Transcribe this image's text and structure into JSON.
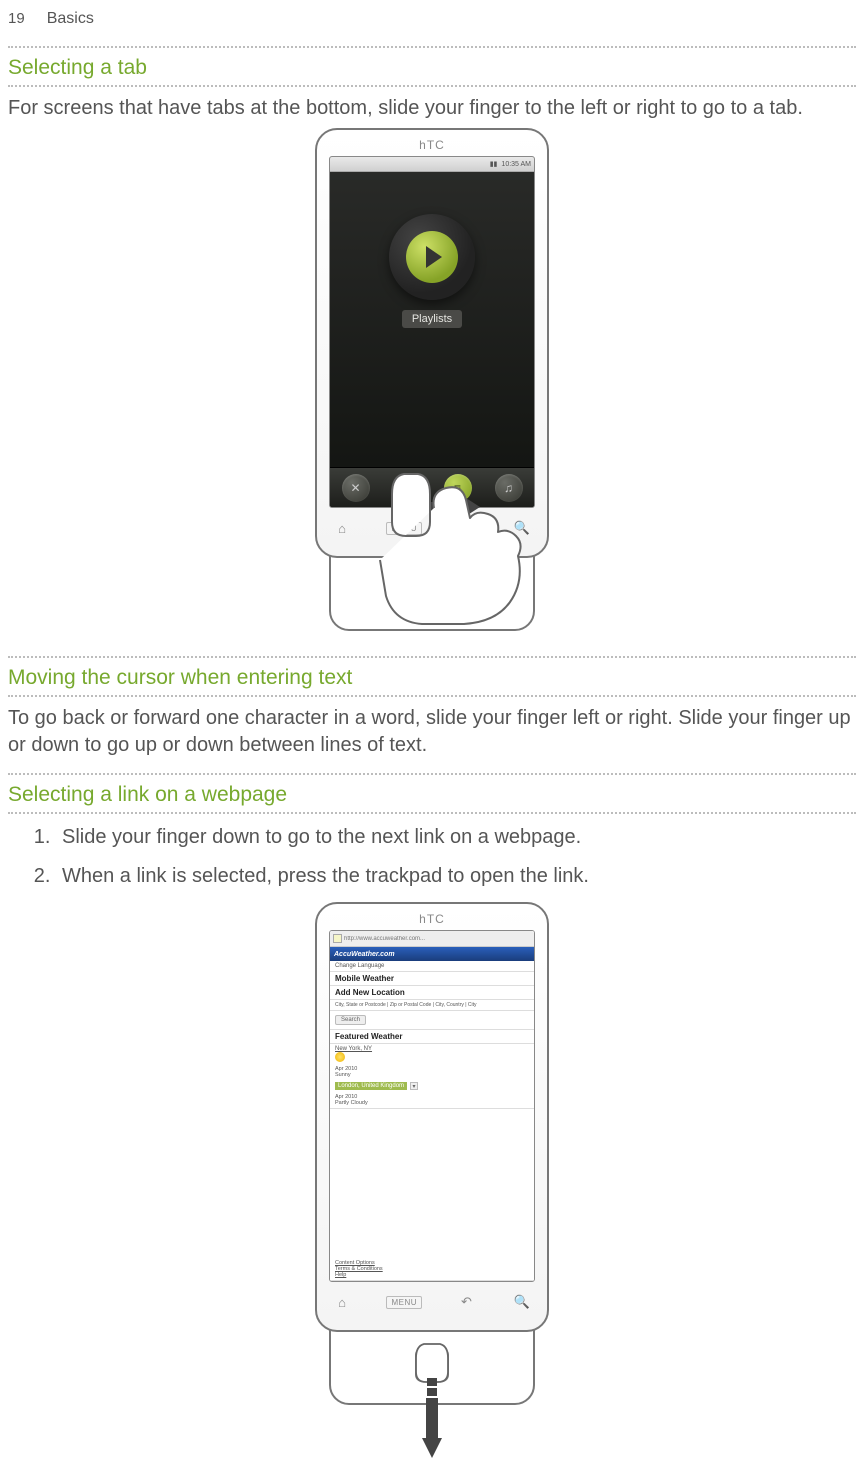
{
  "page": {
    "number": "19",
    "chapter": "Basics"
  },
  "sections": {
    "selecting_tab": {
      "heading": "Selecting a tab",
      "body": "For screens that have tabs at the bottom, slide your finger to the left or right to go to a tab."
    },
    "moving_cursor": {
      "heading": "Moving the cursor when entering text",
      "body": "To go back or forward one character in a word, slide your finger left or right. Slide your finger up or down to go up or down between lines of text."
    },
    "selecting_link": {
      "heading": "Selecting a link on a webpage",
      "steps": [
        "Slide your finger down to go to the next link on a webpage.",
        "When a link is selected, press the trackpad to open the link."
      ]
    }
  },
  "phone1": {
    "logo": "hTC",
    "status_time": "10:35 AM",
    "app_label": "Playlists",
    "tab_icons": [
      "✕",
      "▣",
      "≡",
      "♫"
    ],
    "hw_menu": "MENU"
  },
  "phone2": {
    "logo": "hTC",
    "url": "http://www.accuweather.com...",
    "banner": "AccuWeather.com",
    "lang": "Change Language",
    "mobile_weather": "Mobile Weather",
    "add_loc": "Add New Location",
    "hint": "City, State or Postcode | Zip or Postal Code | City, Country | City",
    "search_btn": "Search",
    "featured": "Featured Weather",
    "city1": "New York, NY",
    "date1": "Apr 2010",
    "cond1": "Sunny",
    "selected_link": "London, United Kingdom",
    "date2": "Apr 2010",
    "cond2": "Partly Cloudy",
    "footer1": "Content Options",
    "footer2": "Terms & Conditions",
    "footer3": "Help",
    "hw_menu": "MENU"
  }
}
